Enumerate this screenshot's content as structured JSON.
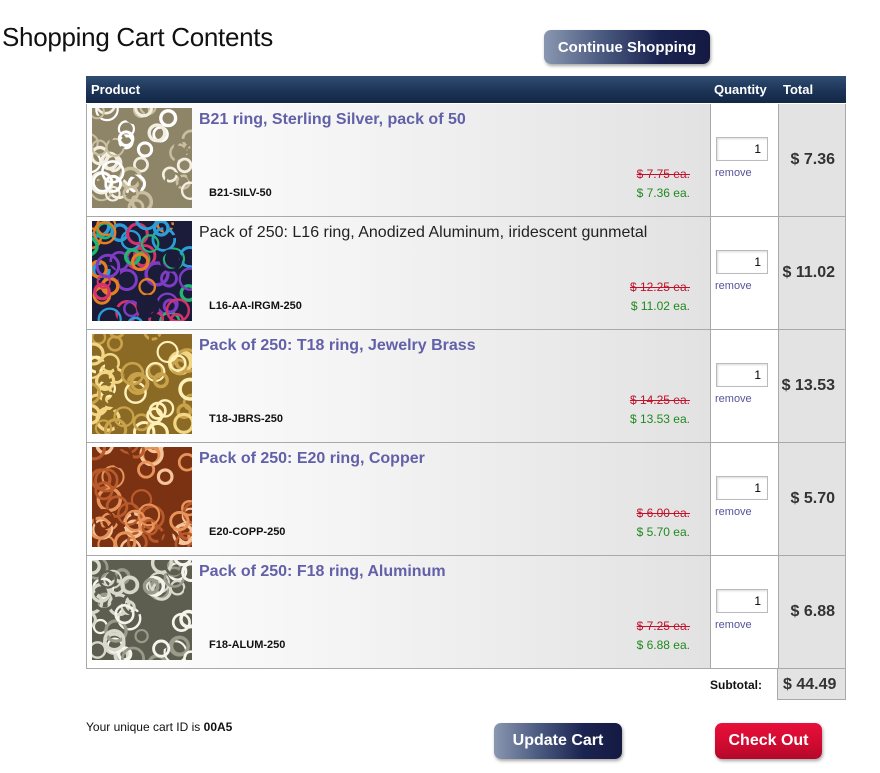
{
  "page": {
    "title": "Shopping Cart Contents",
    "continue_label": "Continue Shopping",
    "update_label": "Update Cart",
    "checkout_label": "Check Out"
  },
  "table": {
    "headers": {
      "product": "Product",
      "quantity": "Quantity",
      "total": "Total"
    }
  },
  "items": [
    {
      "name": "B21 ring, Sterling Silver, pack of 50",
      "name_style": "link",
      "sku": "B21-SILV-50",
      "old_price": "$ 7.75 ea.",
      "new_price": "$ 7.36 ea.",
      "qty": "1",
      "remove": "remove",
      "total": "$ 7.36",
      "colors": [
        "#f2eee0",
        "#c9bf9f",
        "#8e8468",
        "#ffffff"
      ]
    },
    {
      "name": "Pack of 250: L16 ring, Anodized Aluminum, iridescent gunmetal",
      "name_style": "plain",
      "sku": "L16-AA-IRGM-250",
      "old_price": "$ 12.25 ea.",
      "new_price": "$ 11.02 ea.",
      "qty": "1",
      "remove": "remove",
      "total": "$ 11.02",
      "colors": [
        "#d6336c",
        "#2a9ed8",
        "#e67e22",
        "#7d3cc2",
        "#22b573",
        "#1b1b3a"
      ]
    },
    {
      "name": "Pack of 250: T18 ring, Jewelry Brass",
      "name_style": "link",
      "sku": "T18-JBRS-250",
      "old_price": "$ 14.25 ea.",
      "new_price": "$ 13.53 ea.",
      "qty": "1",
      "remove": "remove",
      "total": "$ 13.53",
      "colors": [
        "#f3d684",
        "#c9a24a",
        "#8a6a25",
        "#fff0b8"
      ]
    },
    {
      "name": "Pack of 250: E20 ring, Copper",
      "name_style": "link",
      "sku": "E20-COPP-250",
      "old_price": "$ 6.00 ea.",
      "new_price": "$ 5.70 ea.",
      "qty": "1",
      "remove": "remove",
      "total": "$ 5.70",
      "colors": [
        "#e8935a",
        "#b85a2c",
        "#7a3212",
        "#f6c49a"
      ]
    },
    {
      "name": "Pack of 250: F18 ring, Aluminum",
      "name_style": "link",
      "sku": "F18-ALUM-250",
      "old_price": "$ 7.25 ea.",
      "new_price": "$ 6.88 ea.",
      "qty": "1",
      "remove": "remove",
      "total": "$ 6.88",
      "colors": [
        "#d8d8cc",
        "#9a9a8a",
        "#5e5e50",
        "#f4f4ec"
      ]
    }
  ],
  "subtotal": {
    "label": "Subtotal:",
    "value": "$ 44.49"
  },
  "cart_id": {
    "prefix": "Your unique cart ID is",
    "value": "00A5"
  }
}
